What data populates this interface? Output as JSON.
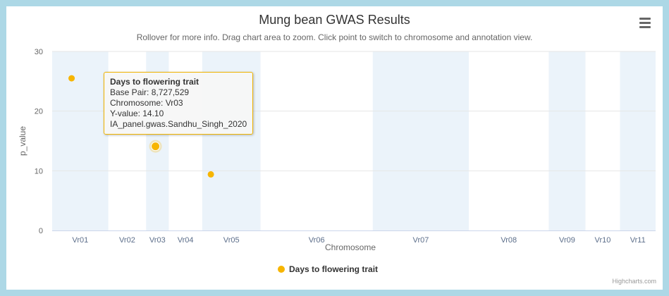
{
  "colors": {
    "series": "#f7b500",
    "band": "#ebf3fa",
    "axis_line": "#ccd6eb",
    "grid": "#e6e6e6",
    "tick_label": "#666666",
    "category_label": "#5c6e8a"
  },
  "chart_data": {
    "type": "scatter",
    "title": "Mung bean GWAS Results",
    "subtitle": "Rollover for more info. Drag chart area to zoom. Click point to switch to chromosome and annotation view.",
    "xlabel": "Chromosome",
    "ylabel": "p_value",
    "ylim": [
      0,
      30
    ],
    "yticks": [
      "0",
      "10",
      "20",
      "30"
    ],
    "chromosomes": [
      {
        "name": "Vr01",
        "start_mb": 0,
        "end_mb": 52,
        "band": true
      },
      {
        "name": "Vr02",
        "start_mb": 52,
        "end_mb": 87,
        "band": false
      },
      {
        "name": "Vr03",
        "start_mb": 87,
        "end_mb": 108,
        "band": true
      },
      {
        "name": "Vr04",
        "start_mb": 108,
        "end_mb": 139,
        "band": false
      },
      {
        "name": "Vr05",
        "start_mb": 139,
        "end_mb": 193,
        "band": true
      },
      {
        "name": "Vr06",
        "start_mb": 193,
        "end_mb": 297,
        "band": false
      },
      {
        "name": "Vr07",
        "start_mb": 297,
        "end_mb": 386,
        "band": true
      },
      {
        "name": "Vr08",
        "start_mb": 386,
        "end_mb": 460,
        "band": false
      },
      {
        "name": "Vr09",
        "start_mb": 460,
        "end_mb": 494,
        "band": true
      },
      {
        "name": "Vr10",
        "start_mb": 494,
        "end_mb": 526,
        "band": false
      },
      {
        "name": "Vr11",
        "start_mb": 526,
        "end_mb": 559,
        "band": true
      }
    ],
    "series": [
      {
        "name": "Days to flowering trait",
        "points": [
          {
            "chromosome": "Vr01",
            "position_mb": 18.0,
            "y": 25.5
          },
          {
            "chromosome": "Vr03",
            "position_mb": 8.727529,
            "y": 14.1,
            "highlighted": true
          },
          {
            "chromosome": "Vr05",
            "position_mb": 8.0,
            "y": 9.4
          }
        ]
      }
    ],
    "legend": {
      "placement": "bottom-center",
      "label": "Days to flowering trait"
    }
  },
  "tooltip": {
    "title": "Days to flowering trait",
    "base_pair": "Base Pair: 8,727,529",
    "chromosome": "Chromosome: Vr03",
    "y_value": "Y-value: 14.10",
    "dataset": "IA_panel.gwas.Sandhu_Singh_2020"
  },
  "credits": "Highcharts.com"
}
